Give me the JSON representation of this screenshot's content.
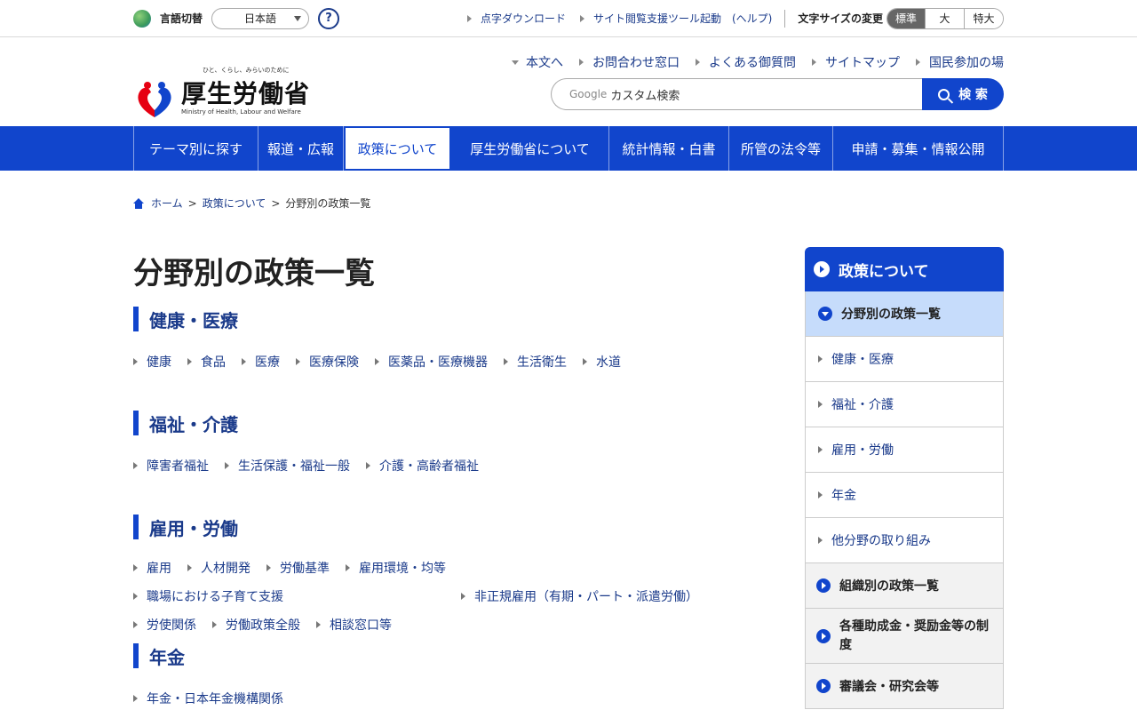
{
  "util": {
    "lang_label": "言語切替",
    "lang_value": "日本語",
    "help": "?",
    "links": [
      "点字ダウンロード",
      "サイト閲覧支援ツール起動　(ヘルプ)"
    ],
    "font_size_label": "文字サイズの変更",
    "font_sizes": [
      "標準",
      "大",
      "特大"
    ]
  },
  "header": {
    "tagline": "ひと、くらし、みらいのために",
    "org_name": "厚生労働省",
    "org_name_en": "Ministry of Health, Labour and Welfare",
    "links": [
      "本文へ",
      "お問合わせ窓口",
      "よくある御質問",
      "サイトマップ",
      "国民参加の場"
    ],
    "search_google": "Google",
    "search_placeholder": "カスタム検索",
    "search_button": "検 索"
  },
  "gnav": [
    "テーマ別に探す",
    "報道・広報",
    "政策について",
    "厚生労働省について",
    "統計情報・白書",
    "所管の法令等",
    "申請・募集・情報公開"
  ],
  "breadcrumb": {
    "home": "ホーム",
    "parent": "政策について",
    "current": "分野別の政策一覧"
  },
  "main": {
    "title": "分野別の政策一覧",
    "sections": [
      {
        "heading": "健康・医療",
        "links": [
          "健康",
          "食品",
          "医療",
          "医療保険",
          "医薬品・医療機器",
          "生活衛生",
          "水道"
        ]
      },
      {
        "heading": "福祉・介護",
        "links": [
          "障害者福祉",
          "生活保護・福祉一般",
          "介護・高齢者福祉"
        ]
      },
      {
        "heading": "雇用・労働",
        "links": [
          "雇用",
          "人材開発",
          "労働基準",
          "雇用環境・均等",
          "職場における子育て支援",
          "非正規雇用（有期・パート・派遣労働）",
          "労使関係",
          "労働政策全般",
          "相談窓口等"
        ]
      },
      {
        "heading": "年金",
        "links": [
          "年金・日本年金機構関係"
        ]
      }
    ]
  },
  "side": {
    "head": "政策について",
    "current": "分野別の政策一覧",
    "subs": [
      "健康・医療",
      "福祉・介護",
      "雇用・労働",
      "年金",
      "他分野の取り組み"
    ],
    "groups": [
      "組織別の政策一覧",
      "各種助成金・奨励金等の制度",
      "審議会・研究会等"
    ]
  }
}
